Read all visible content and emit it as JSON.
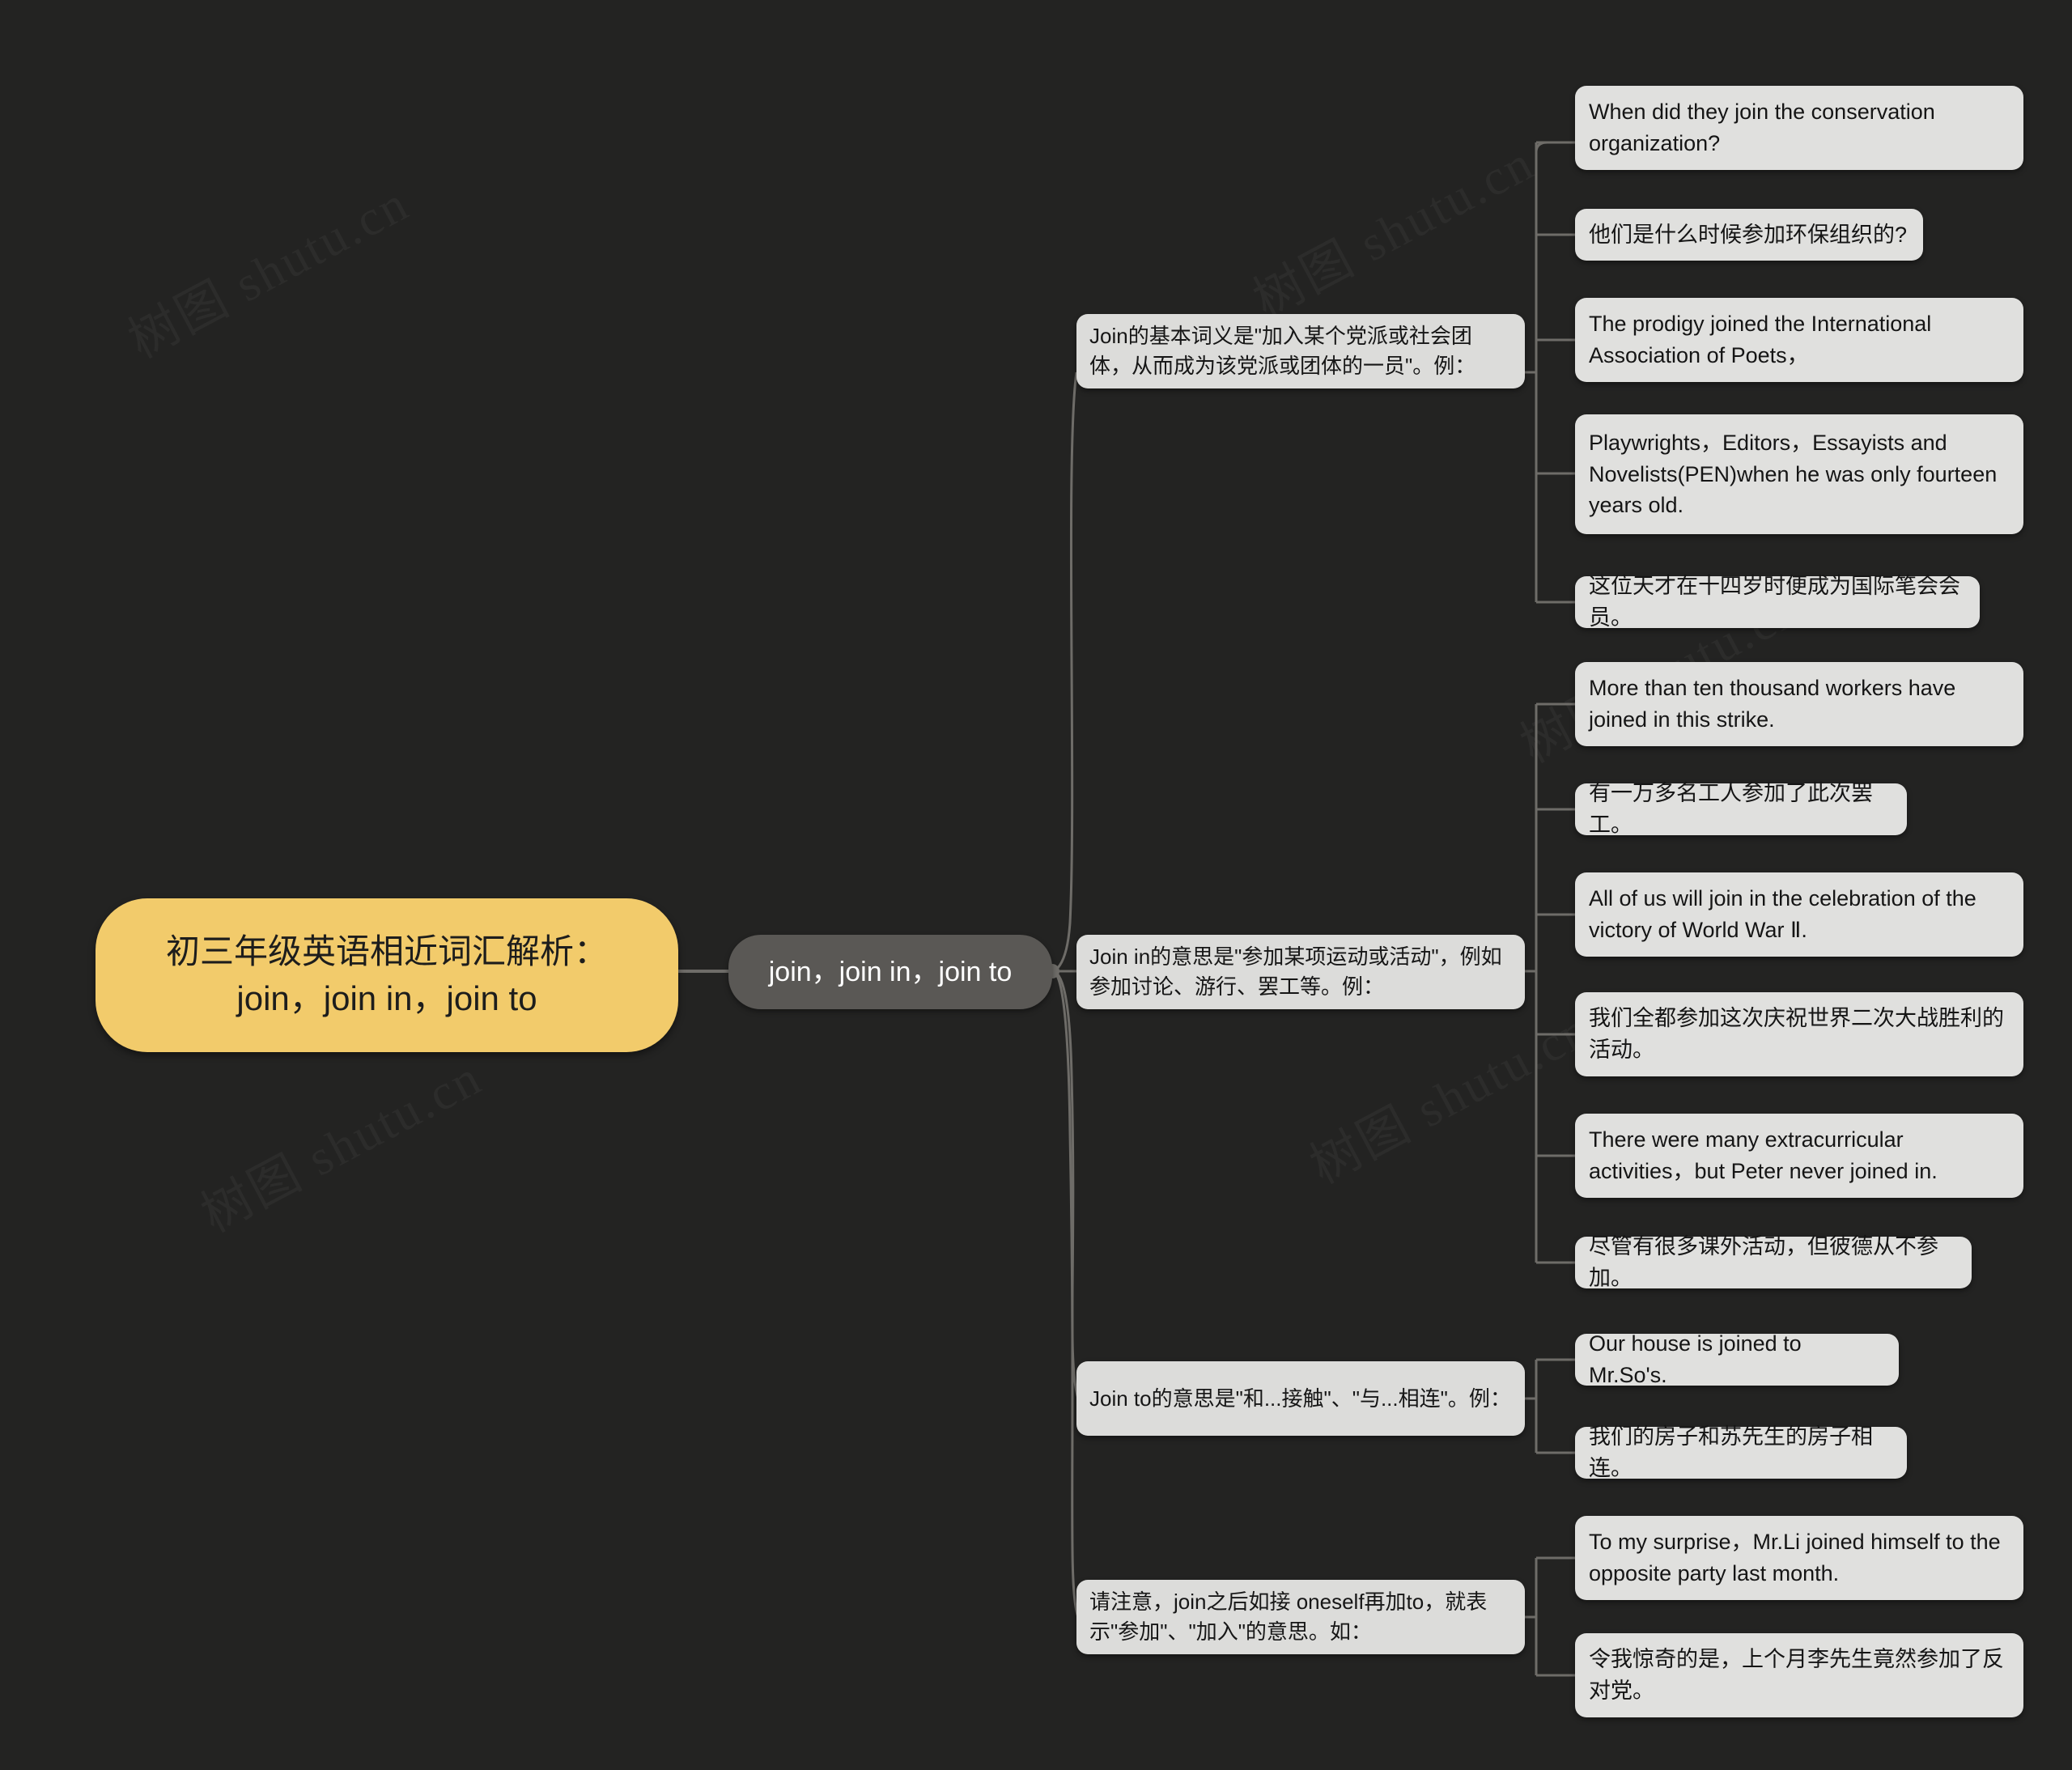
{
  "meta": {
    "background_color": "#232322",
    "root_color": "#f2cb6b",
    "topic_color": "#5a5855",
    "node_color": "#dcdcda",
    "link_color": "#6e6c68"
  },
  "watermark": {
    "text": "树图 shutu.cn"
  },
  "root": {
    "label": "初三年级英语相近词汇解析：join，join in，join to"
  },
  "topic": {
    "label": "join，join in，join to"
  },
  "branches": [
    {
      "id": "join",
      "label": "Join的基本词义是\"加入某个党派或社会团体，从而成为该党派或团体的一员\"。例：",
      "children": [
        {
          "label": "When did they join the conservation organization?"
        },
        {
          "label": "他们是什么时候参加环保组织的?"
        },
        {
          "label": "The prodigy joined the International Association of Poets，"
        },
        {
          "label": "Playwrights，Editors，Essayists and Novelists(PEN)when he was only fourteen years old."
        },
        {
          "label": "这位天才在十四岁时便成为国际笔会会员。"
        }
      ]
    },
    {
      "id": "join-in",
      "label": "Join in的意思是\"参加某项运动或活动\"，例如参加讨论、游行、罢工等。例：",
      "children": [
        {
          "label": "More than ten thousand workers have joined in this strike."
        },
        {
          "label": "有一万多名工人参加了此次罢工。"
        },
        {
          "label": "All of us will join in the celebration of the victory of World War Ⅱ."
        },
        {
          "label": "我们全都参加这次庆祝世界二次大战胜利的活动。"
        },
        {
          "label": "There were many extracurricular activities，but Peter never joined in."
        },
        {
          "label": "尽管有很多课外活动，但彼德从不参加。"
        }
      ]
    },
    {
      "id": "join-to",
      "label": "Join to的意思是\"和...接触\"、\"与...相连\"。例：",
      "children": [
        {
          "label": "Our house is joined to Mr.So's."
        },
        {
          "label": "我们的房子和苏先生的房子相连。"
        }
      ]
    },
    {
      "id": "join-oneself-to",
      "label": "请注意，join之后如接 oneself再加to，就表示\"参加\"、\"加入\"的意思。如：",
      "children": [
        {
          "label": "To my surprise，Mr.Li joined himself to the opposite party last month."
        },
        {
          "label": "令我惊奇的是，上个月李先生竟然参加了反对党。"
        }
      ]
    }
  ]
}
